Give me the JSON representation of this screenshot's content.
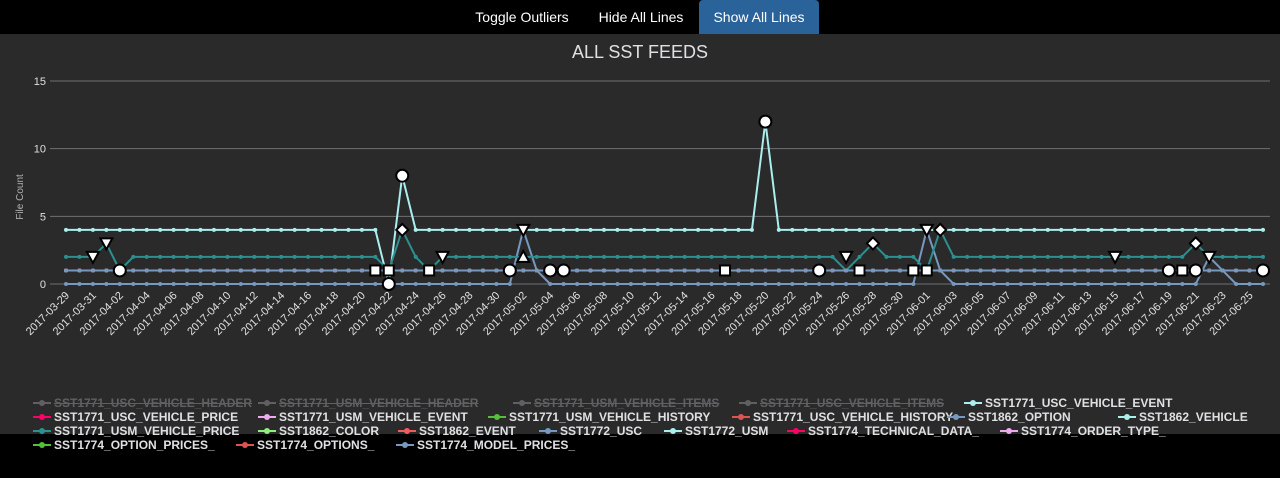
{
  "toolbar": {
    "toggle_outliers": "Toggle Outliers",
    "hide_all": "Hide All Lines",
    "show_all": "Show All Lines"
  },
  "colors": {
    "background": "#2a2a2b",
    "page": "#000000",
    "active_button": "#2a6399",
    "grid": "#707073",
    "text": "#e0e0e3",
    "hidden_legend": "#606063"
  },
  "chart_data": {
    "type": "line",
    "title": "ALL SST FEEDS",
    "xlabel": "",
    "ylabel": "File Count",
    "ylim": [
      0,
      15
    ],
    "yticks": [
      0,
      5,
      10,
      15
    ],
    "grid": true,
    "legend_placement": "bottom",
    "x_start": "2017-03-29",
    "x_end": "2017-06-26",
    "xtick_labels": [
      "2017-03-29",
      "2017-03-31",
      "2017-04-02",
      "2017-04-04",
      "2017-04-06",
      "2017-04-08",
      "2017-04-10",
      "2017-04-12",
      "2017-04-14",
      "2017-04-16",
      "2017-04-18",
      "2017-04-20",
      "2017-04-22",
      "2017-04-24",
      "2017-04-26",
      "2017-04-28",
      "2017-04-30",
      "2017-05-02",
      "2017-05-04",
      "2017-05-06",
      "2017-05-08",
      "2017-05-10",
      "2017-05-12",
      "2017-05-14",
      "2017-05-16",
      "2017-05-18",
      "2017-05-20",
      "2017-05-22",
      "2017-05-24",
      "2017-05-26",
      "2017-05-28",
      "2017-05-30",
      "2017-06-01",
      "2017-06-03",
      "2017-06-05",
      "2017-06-07",
      "2017-06-09",
      "2017-06-11",
      "2017-06-13",
      "2017-06-15",
      "2017-06-17",
      "2017-06-19",
      "2017-06-21",
      "2017-06-23",
      "2017-06-25"
    ],
    "series": [
      {
        "name": "SST1771_USC_VEHICLE_HEADER",
        "color": "#2b908f",
        "visible": false,
        "base": 0,
        "changes": {}
      },
      {
        "name": "SST1771_USM_VEHICLE_HEADER",
        "color": "#90ee7e",
        "visible": false,
        "base": 0,
        "changes": {}
      },
      {
        "name": "SST1771_USM_VEHICLE_ITEMS",
        "color": "#f45b5b",
        "visible": false,
        "base": 0,
        "changes": {}
      },
      {
        "name": "SST1771_USC_VEHICLE_ITEMS",
        "color": "#7798bf",
        "visible": false,
        "base": 0,
        "changes": {}
      },
      {
        "name": "SST1771_USC_VEHICLE_EVENT",
        "color": "#aaeeee",
        "visible": true,
        "base": 4,
        "changes": {
          "2017-04-22": 0,
          "2017-04-23": 8,
          "2017-05-20": 12
        }
      },
      {
        "name": "SST1771_USC_VEHICLE_PRICE",
        "color": "#ff0066",
        "visible": true,
        "base": 1,
        "changes": {}
      },
      {
        "name": "SST1771_USM_VEHICLE_EVENT",
        "color": "#eeaaee",
        "visible": true,
        "base": 1,
        "changes": {}
      },
      {
        "name": "SST1771_USM_VEHICLE_HISTORY",
        "color": "#55bf3b",
        "visible": true,
        "base": 1,
        "changes": {}
      },
      {
        "name": "SST1771_USC_VEHICLE_HISTORY",
        "color": "#df5353",
        "visible": true,
        "base": 1,
        "changes": {}
      },
      {
        "name": "SST1862_OPTION",
        "color": "#7798bf",
        "visible": true,
        "base": 0,
        "changes": {
          "2017-05-02": 4,
          "2017-05-03": 1,
          "2017-06-01": 4,
          "2017-06-02": 1,
          "2017-06-22": 2,
          "2017-06-23": 1
        }
      },
      {
        "name": "SST1862_VEHICLE",
        "color": "#aaeeee",
        "visible": true,
        "base": 1,
        "changes": {}
      },
      {
        "name": "SST1771_USM_VEHICLE_PRICE",
        "color": "#2b908f",
        "visible": true,
        "base": 2,
        "changes": {
          "2017-03-31": 2,
          "2017-04-01": 3,
          "2017-04-02": 1,
          "2017-04-22": 1,
          "2017-04-23": 4,
          "2017-04-25": 1,
          "2017-04-26": 2,
          "2017-05-26": 1,
          "2017-05-28": 3,
          "2017-06-01": 1,
          "2017-06-02": 4,
          "2017-06-03": 2,
          "2017-06-21": 3,
          "2017-06-22": 2
        }
      },
      {
        "name": "SST1862_COLOR",
        "color": "#90ee7e",
        "visible": true,
        "base": 1,
        "changes": {}
      },
      {
        "name": "SST1862_EVENT",
        "color": "#f45b5b",
        "visible": true,
        "base": 1,
        "changes": {
          "2017-05-01": 1,
          "2017-05-04": 1,
          "2017-05-05": 1
        }
      },
      {
        "name": "SST1772_USC",
        "color": "#7798bf",
        "visible": true,
        "base": 1,
        "changes": {}
      },
      {
        "name": "SST1772_USM",
        "color": "#aaeeee",
        "visible": true,
        "base": 1,
        "changes": {}
      },
      {
        "name": "SST1774_TECHNICAL_DATA_",
        "color": "#ff0066",
        "visible": true,
        "base": 1,
        "changes": {}
      },
      {
        "name": "SST1774_ORDER_TYPE_",
        "color": "#eeaaee",
        "visible": true,
        "base": 1,
        "changes": {}
      },
      {
        "name": "SST1774_OPTION_PRICES_",
        "color": "#55bf3b",
        "visible": true,
        "base": 1,
        "changes": {}
      },
      {
        "name": "SST1774_OPTIONS_",
        "color": "#df5353",
        "visible": true,
        "base": 1,
        "changes": {}
      },
      {
        "name": "SST1774_MODEL_PRICES_",
        "color": "#7798bf",
        "visible": true,
        "base": 1,
        "changes": {}
      }
    ],
    "outlier_markers": [
      {
        "date": "2017-04-23",
        "y": 8,
        "shape": "circle"
      },
      {
        "date": "2017-05-20",
        "y": 12,
        "shape": "circle"
      },
      {
        "date": "2017-04-02",
        "y": 1,
        "shape": "circle"
      },
      {
        "date": "2017-05-01",
        "y": 1,
        "shape": "circle"
      },
      {
        "date": "2017-05-04",
        "y": 1,
        "shape": "circle"
      },
      {
        "date": "2017-05-05",
        "y": 1,
        "shape": "circle"
      },
      {
        "date": "2017-05-24",
        "y": 1,
        "shape": "circle"
      },
      {
        "date": "2017-06-19",
        "y": 1,
        "shape": "circle"
      },
      {
        "date": "2017-06-21",
        "y": 1,
        "shape": "circle"
      },
      {
        "date": "2017-06-26",
        "y": 1,
        "shape": "circle"
      },
      {
        "date": "2017-04-22",
        "y": 0,
        "shape": "circle"
      },
      {
        "date": "2017-04-01",
        "y": 3,
        "shape": "triangle-down"
      },
      {
        "date": "2017-03-31",
        "y": 2,
        "shape": "triangle-down"
      },
      {
        "date": "2017-04-26",
        "y": 2,
        "shape": "triangle-down"
      },
      {
        "date": "2017-05-02",
        "y": 4,
        "shape": "triangle-down"
      },
      {
        "date": "2017-05-26",
        "y": 2,
        "shape": "triangle-down"
      },
      {
        "date": "2017-06-01",
        "y": 4,
        "shape": "triangle-down"
      },
      {
        "date": "2017-06-15",
        "y": 2,
        "shape": "triangle-down"
      },
      {
        "date": "2017-06-22",
        "y": 2,
        "shape": "triangle-down"
      },
      {
        "date": "2017-05-02",
        "y": 2,
        "shape": "triangle"
      },
      {
        "date": "2017-04-23",
        "y": 4,
        "shape": "diamond"
      },
      {
        "date": "2017-05-28",
        "y": 3,
        "shape": "diamond"
      },
      {
        "date": "2017-06-02",
        "y": 4,
        "shape": "diamond"
      },
      {
        "date": "2017-06-21",
        "y": 3,
        "shape": "diamond"
      },
      {
        "date": "2017-04-21",
        "y": 1,
        "shape": "square"
      },
      {
        "date": "2017-04-22",
        "y": 1,
        "shape": "square"
      },
      {
        "date": "2017-04-25",
        "y": 1,
        "shape": "square"
      },
      {
        "date": "2017-05-17",
        "y": 1,
        "shape": "square"
      },
      {
        "date": "2017-05-27",
        "y": 1,
        "shape": "square"
      },
      {
        "date": "2017-05-31",
        "y": 1,
        "shape": "square"
      },
      {
        "date": "2017-06-01",
        "y": 1,
        "shape": "square"
      },
      {
        "date": "2017-06-20",
        "y": 1,
        "shape": "square"
      }
    ]
  }
}
